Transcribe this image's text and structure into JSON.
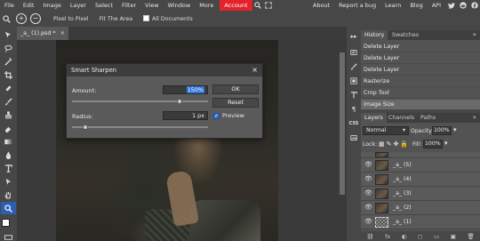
{
  "menubar": {
    "items": [
      "File",
      "Edit",
      "Image",
      "Layer",
      "Select",
      "Filter",
      "View",
      "Window",
      "More"
    ],
    "account_label": "Account",
    "right_links": [
      "About",
      "Report a bug",
      "Learn",
      "Blog",
      "API"
    ],
    "social_icons": [
      "twitter-icon",
      "reddit-icon",
      "facebook-icon"
    ]
  },
  "options": {
    "pixel_to_pixel": "Pixel to Pixel",
    "fit_area": "Fit The Area",
    "all_documents": "All Documents"
  },
  "document": {
    "tab_label": "_a_ (1).psd *"
  },
  "dialog": {
    "title": "Smart Sharpen",
    "amount_label": "Amount:",
    "amount_value": "150%",
    "amount_fraction": 0.79,
    "radius_label": "Radius:",
    "radius_value": "1 px",
    "radius_fraction": 0.1,
    "ok_label": "OK",
    "reset_label": "Reset",
    "preview_label": "Preview",
    "preview_checked": true
  },
  "history": {
    "tabs": [
      "History",
      "Swatches"
    ],
    "items": [
      "Delete Layer",
      "Delete Layer",
      "Delete Layer",
      "Rasterize",
      "Crop Tool",
      "Image Size"
    ]
  },
  "layers": {
    "tabs": [
      "Layers",
      "Channels",
      "Paths"
    ],
    "blend_mode": "Normal",
    "opacity_label": "Opacity:",
    "opacity_value": "100%",
    "lock_label": "Lock:",
    "fill_label": "Fill:",
    "fill_value": "100%",
    "items": [
      "_a_ (5)",
      "_a_ (4)",
      "_a_ (3)",
      "_a_ (2)",
      "_a_ (1)"
    ]
  },
  "colors": {
    "accent_account": "#e2232a",
    "selection_blue": "#2f75d6"
  }
}
